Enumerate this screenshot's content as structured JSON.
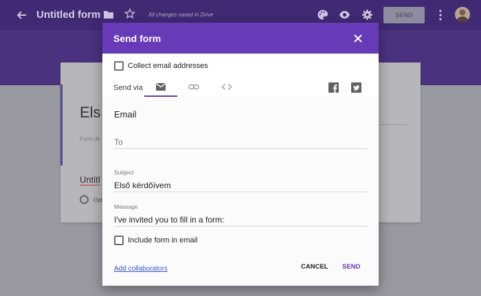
{
  "app": {
    "form_title": "Untitled form",
    "saved_status": "All changes saved in Drive",
    "send_button": "SEND",
    "form_heading": "Els",
    "form_description": "Form de",
    "question_title": "Untitl",
    "option_label": "Opt"
  },
  "dialog": {
    "title": "Send form",
    "collect_email_label": "Collect email addresses",
    "send_via_label": "Send via",
    "tabs": [
      {
        "icon": "email-icon",
        "active": true
      },
      {
        "icon": "link-icon",
        "active": false
      },
      {
        "icon": "embed-icon",
        "active": false
      }
    ],
    "share_icons": [
      "facebook-icon",
      "twitter-icon"
    ],
    "section_title": "Email",
    "to_placeholder": "To",
    "subject_label": "Subject",
    "subject_value": "Első kérdőívem",
    "message_label": "Message",
    "message_value": "I've invited you to fill in a form:",
    "include_form_label": "Include form in email",
    "add_collaborators": "Add collaborators",
    "cancel": "CANCEL",
    "send": "SEND"
  },
  "colors": {
    "accent": "#673ab7",
    "header_dimmed": "#3f2a73",
    "link": "#3a55c9"
  }
}
